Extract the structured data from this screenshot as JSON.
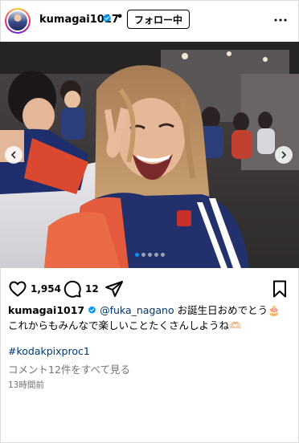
{
  "header": {
    "username": "kumagai1017",
    "separator": "•",
    "follow_label": "フォロー中",
    "more_icon": "more-horizontal-icon",
    "verified_icon": "verified-badge-icon"
  },
  "media": {
    "slide_count": 5,
    "active_slide": 1,
    "prev_icon": "chevron-left-icon",
    "next_icon": "chevron-right-icon"
  },
  "actions": {
    "like_icon": "heart-icon",
    "likes": "1,954",
    "comment_icon": "comment-icon",
    "comments": "12",
    "share_icon": "share-icon",
    "save_icon": "bookmark-icon"
  },
  "caption": {
    "username": "kumagai1017",
    "mention": "@fuka_nagano",
    "line1_text": " お誕生日おめでとう",
    "line1_emoji": "🎂",
    "line2": "これからもみんなで楽しいことたくさんしようね🫶🏻"
  },
  "hashtag": "#kodakpixproc1",
  "view_comments": "コメント12件をすべて見る",
  "timestamp": "13時間前",
  "colors": {
    "link": "#00376b",
    "muted": "#737373",
    "accent": "#0095f6"
  }
}
